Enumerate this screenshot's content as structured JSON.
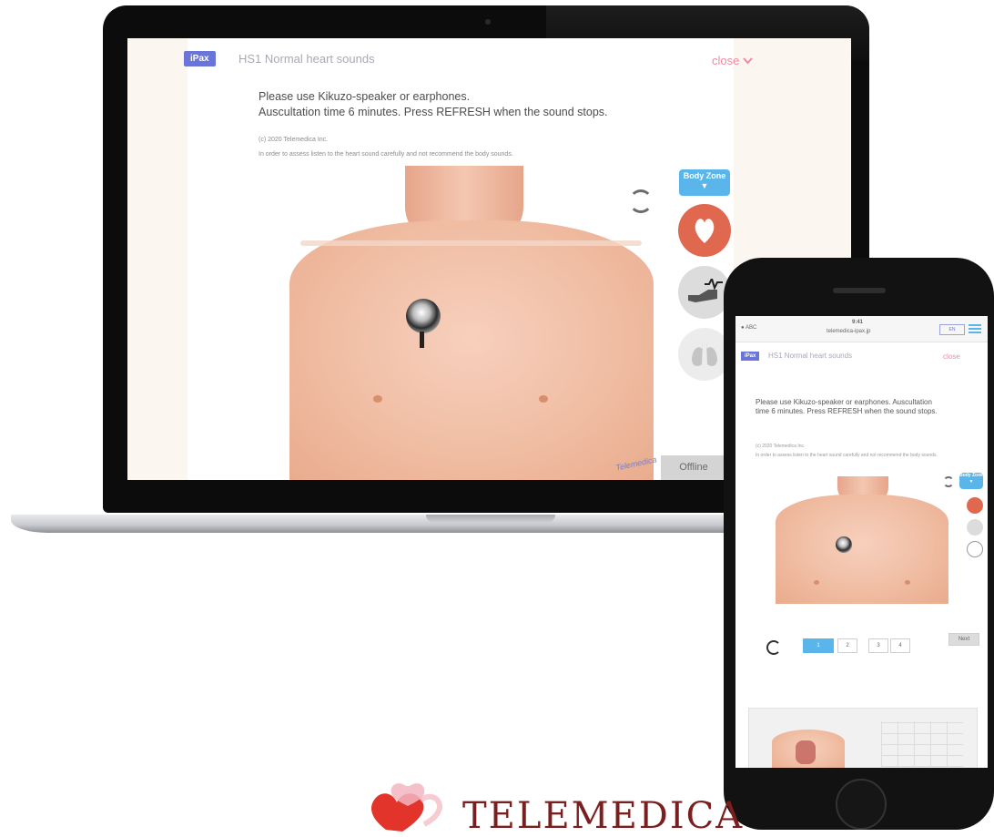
{
  "app": {
    "module_badge": "iPax",
    "module_title": "HS1 Normal heart sounds",
    "close_label": "close",
    "close_arrow": "⌄"
  },
  "instructions": {
    "line1": "Please use Kikuzo-speaker or earphones.",
    "line2": "Auscultation time 6 minutes. Press REFRESH when the sound stops.",
    "copyright": "(c) 2020 Telemedica Inc.",
    "notice": "In order to assess listen to the heart sound carefully and not recommend the body sounds."
  },
  "controls": {
    "body_zone_label": "Body Zone ▼",
    "offline_label": "Offline",
    "signature": "Telemedica"
  },
  "phone": {
    "status_left": "● ABC",
    "status_time": "9:41",
    "url": "telemedica-ipax.jp",
    "pager": [
      "1",
      "2",
      "3",
      "4"
    ],
    "next_label": "Next",
    "instructions": "Please use Kikuzo-speaker or earphones. Auscultation time 6 minutes. Press REFRESH when the sound stops."
  },
  "logo": {
    "text": "TELEMEDICA"
  },
  "colors": {
    "badge": "#6a75d9",
    "close": "#f08aa2",
    "body_zone": "#5ab6ea",
    "heart": "#e0684f",
    "logo": "#7a1f1f",
    "logo_heart": "#e2342b"
  },
  "icons": [
    "refresh-icon",
    "heart-icon",
    "hand-pulse-icon",
    "lungs-icon",
    "stethoscope-icon",
    "chevron-down-icon",
    "menu-icon"
  ]
}
